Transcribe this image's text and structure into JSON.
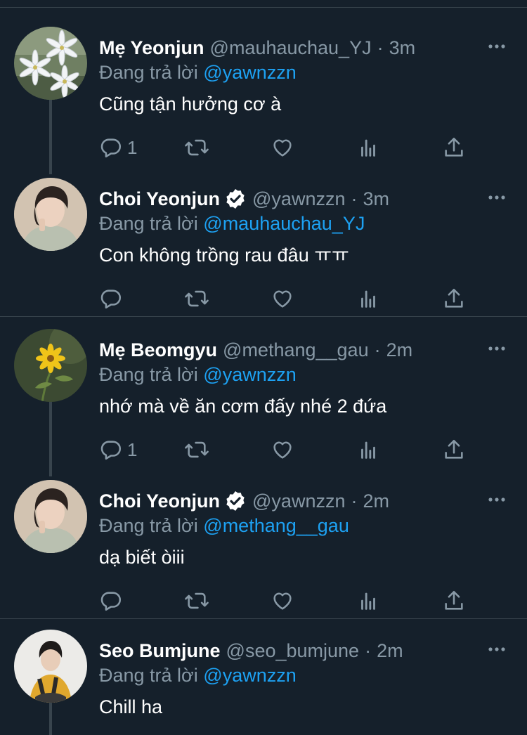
{
  "reply_prefix": "Đang trả lời",
  "tweets": [
    {
      "name": "Mẹ Yeonjun",
      "verified": false,
      "handle": "@mauhauchau_YJ",
      "dot": "·",
      "time": "3m",
      "replying_to": "@yawnzzn",
      "text": "Cũng tận hưởng cơ à",
      "reply_count": "1",
      "avatar": "white-lily-flowers"
    },
    {
      "name": "Choi Yeonjun",
      "verified": true,
      "handle": "@yawnzzn",
      "dot": "·",
      "time": "3m",
      "replying_to": "@mauhauchau_YJ",
      "text": "Con không trồng rau đâu ㅠㅠ",
      "reply_count": "",
      "avatar": "young-man-portrait"
    },
    {
      "name": "Mẹ Beomgyu",
      "verified": false,
      "handle": "@methang__gau",
      "dot": "·",
      "time": "2m",
      "replying_to": "@yawnzzn",
      "text": "nhớ mà về ăn cơm đấy nhé 2 đứa",
      "reply_count": "1",
      "avatar": "yellow-flower"
    },
    {
      "name": "Choi Yeonjun",
      "verified": true,
      "handle": "@yawnzzn",
      "dot": "·",
      "time": "2m",
      "replying_to": "@methang__gau",
      "text": "dạ biết òiii",
      "reply_count": "",
      "avatar": "young-man-portrait"
    },
    {
      "name": "Seo Bumjune",
      "verified": false,
      "handle": "@seo_bumjune",
      "dot": "·",
      "time": "2m",
      "replying_to": "@yawnzzn",
      "text": "Chill ha",
      "reply_count": "",
      "avatar": "man-sitting-portrait"
    }
  ],
  "icons": [
    "reply-icon",
    "retweet-icon",
    "like-icon",
    "analytics-icon",
    "share-icon",
    "more-icon",
    "verified-icon"
  ],
  "colors": {
    "background": "#15202b",
    "secondary_text": "#8899a6",
    "link": "#1da1f2",
    "border": "#38444d"
  }
}
